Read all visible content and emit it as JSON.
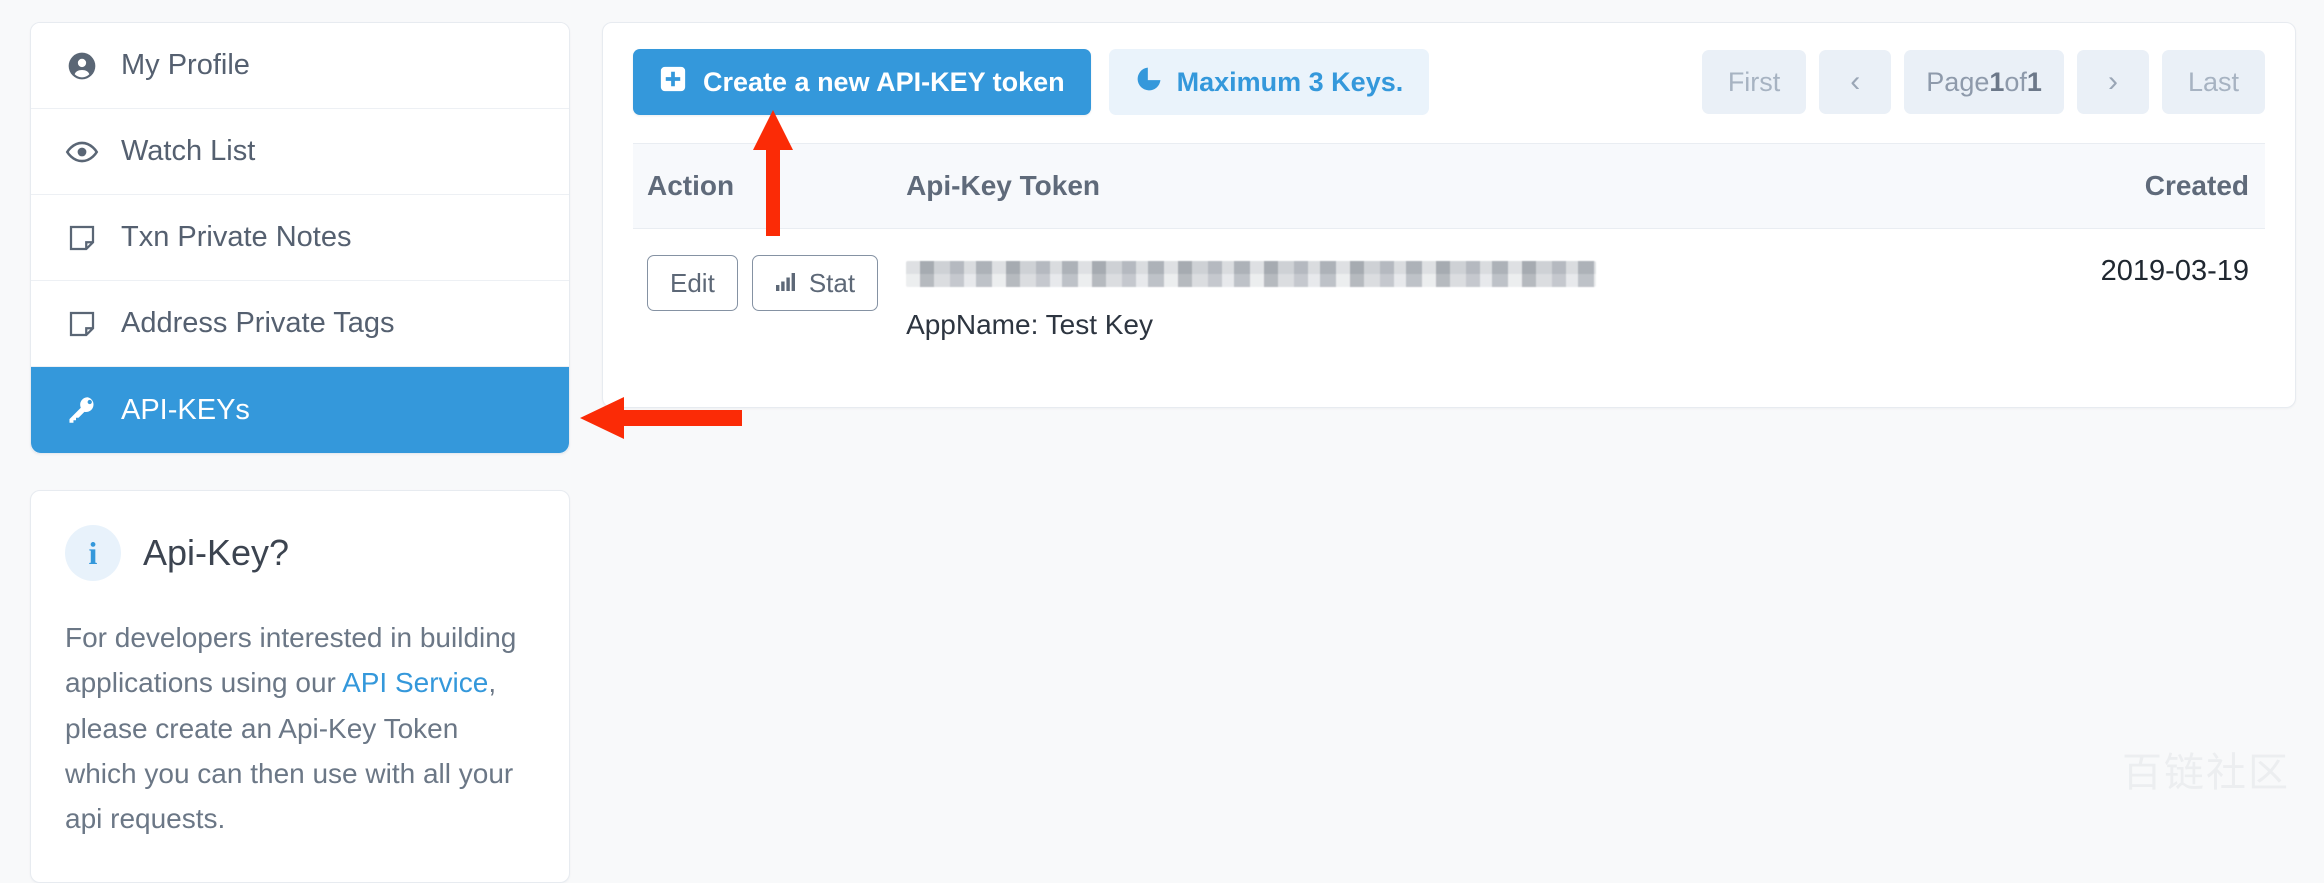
{
  "colors": {
    "accent": "#3498db",
    "accent_soft_bg": "#eaf3fb",
    "page_bg": "#f8f9fa",
    "card_bg": "#ffffff",
    "table_head_bg": "#f7f9fc",
    "pager_bg": "#eaf0f7",
    "annotation_red": "#fb2b06",
    "info_bubble_bg": "#e8f2fb",
    "text_muted": "#6b7786"
  },
  "sidebar": {
    "items": [
      {
        "label": "My Profile",
        "icon": "user-circle-icon",
        "active": false
      },
      {
        "label": "Watch List",
        "icon": "eye-icon",
        "active": false
      },
      {
        "label": "Txn Private Notes",
        "icon": "note-icon",
        "active": false
      },
      {
        "label": "Address Private Tags",
        "icon": "note-icon",
        "active": false
      },
      {
        "label": "API-KEYs",
        "icon": "key-icon",
        "active": true
      }
    ],
    "info_card": {
      "icon": "info-icon",
      "title": "Api-Key?",
      "text_before_link": "For developers interested in building applications using our ",
      "link_label": "API Service",
      "text_after_link": ", please create an Api-Key Token which you can then use with all your api requests."
    }
  },
  "main": {
    "toolbar": {
      "create_button": {
        "label": "Create a new API-KEY token",
        "icon": "plus-square-icon"
      },
      "max_keys_button": {
        "label": "Maximum 3 Keys.",
        "icon": "pie-chart-icon"
      }
    },
    "pagination": {
      "first_label": "First",
      "prev_icon": "chevron-left-icon",
      "prev_glyph": "‹",
      "page_text_prefix": "Page ",
      "current_page": "1",
      "page_text_middle": " of ",
      "total_pages": "1",
      "next_icon": "chevron-right-icon",
      "next_glyph": "›",
      "last_label": "Last"
    },
    "table": {
      "columns": [
        "Action",
        "Api-Key Token",
        "Created"
      ],
      "rows": [
        {
          "edit_label": "Edit",
          "stat_label": "Stat",
          "stat_icon": "bar-chart-icon",
          "token_masked": true,
          "app_name_label": "AppName: Test Key",
          "created": "2019-03-19"
        }
      ]
    }
  },
  "annotations": [
    {
      "name": "arrow-pointing-to-create-button",
      "direction": "up",
      "color": "#fb2b06"
    },
    {
      "name": "arrow-pointing-to-api-keys-nav",
      "direction": "left",
      "color": "#fb2b06"
    }
  ],
  "watermark": {
    "text": "百链社区"
  }
}
